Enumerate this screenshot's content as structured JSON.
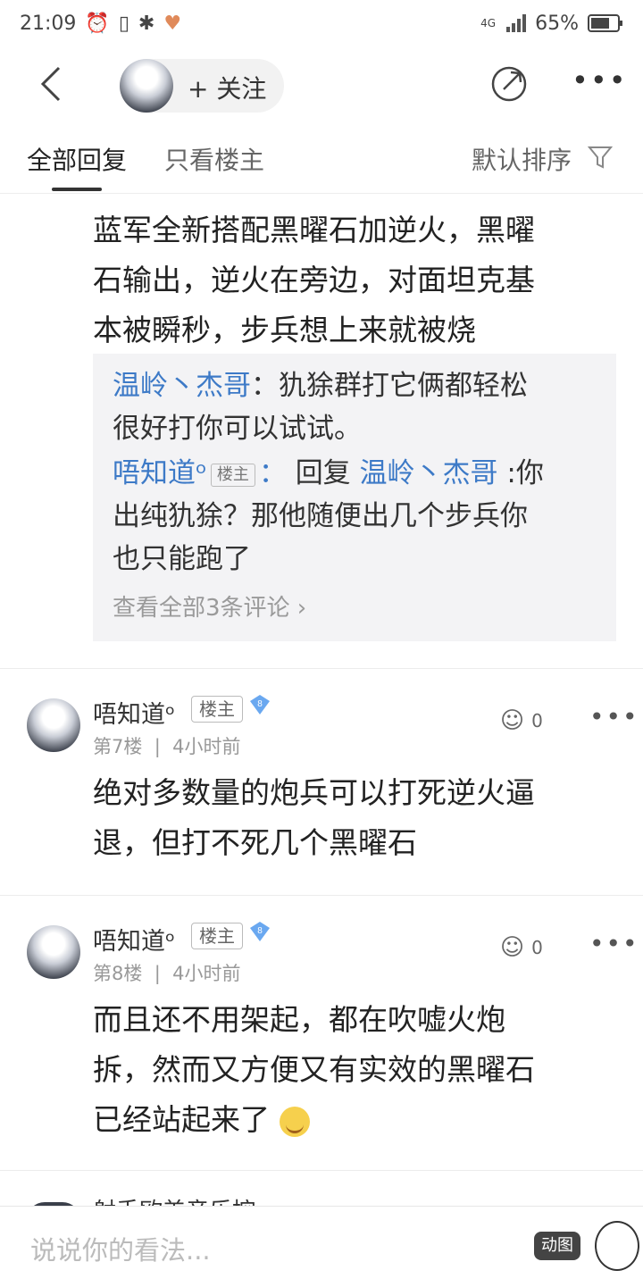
{
  "status_bar": {
    "time": "21:09",
    "network": "4G",
    "battery": "65%"
  },
  "topbar": {
    "follow_label": "+ 关注"
  },
  "tabs": {
    "all_replies": "全部回复",
    "only_op": "只看楼主",
    "sort": "默认排序"
  },
  "post": {
    "lines": [
      "蓝军全新搭配黑曜石加逆火，黑曜",
      "石输出，逆火在旁边，对面坦克基",
      "本被瞬秒，步兵想上来就被烧"
    ],
    "replies": {
      "r1_name": "温岭丶杰哥",
      "r1_text_a": "犰狳群打它俩都轻松",
      "r1_text_b": "很好打你可以试试。",
      "r2_name": "唔知道ᵒ",
      "r2_tag": "楼主",
      "r2_reply_word": "回复",
      "r2_target": "温岭丶杰哥",
      "r2_text_a": ":你",
      "r2_text_b": "出纯犰狳？那他随便出几个步兵你",
      "r2_text_c": "也只能跑了",
      "view_all": "查看全部3条评论"
    }
  },
  "floors": [
    {
      "user": "唔知道ᵒ",
      "tag": "楼主",
      "level": "8",
      "floor": "第7楼",
      "time": "4小时前",
      "likes": "0",
      "lines": [
        "绝对多数量的炮兵可以打死逆火逼",
        "退，但打不死几个黑曜石"
      ]
    },
    {
      "user": "唔知道ᵒ",
      "tag": "楼主",
      "level": "8",
      "floor": "第8楼",
      "time": "4小时前",
      "likes": "0",
      "lines": [
        "而且还不用架起，都在吹嘘火炮",
        "拆，然而又方便又有实效的黑曜石",
        "已经站起来了"
      ]
    }
  ],
  "peek_user": "射手欧美音乐控",
  "bottom_bar": {
    "placeholder": "说说你的看法...",
    "gif_label": "动图"
  },
  "colors": {
    "link_blue": "#3d7ac7",
    "reply_bg": "#f3f3f5"
  }
}
